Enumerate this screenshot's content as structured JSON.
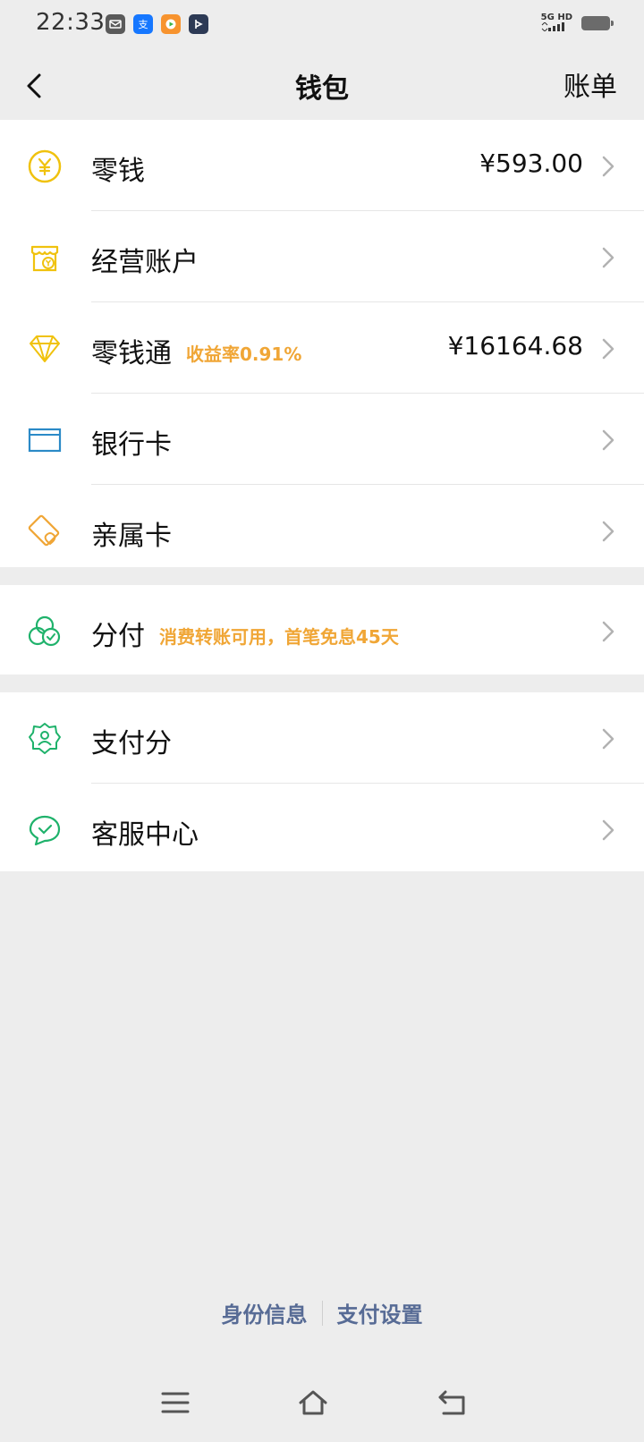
{
  "status_bar": {
    "time": "22:33",
    "network": "5G HD",
    "icons": [
      "mail-app-icon",
      "alipay-icon",
      "video-app-icon",
      "media-app-icon"
    ]
  },
  "navbar": {
    "title": "钱包",
    "right_action": "账单",
    "back_icon": "back-arrow-icon"
  },
  "groups": [
    {
      "items": [
        {
          "icon": "yen-coin-icon",
          "label": "零钱",
          "value": "¥593.00"
        },
        {
          "icon": "shop-account-icon",
          "label": "经营账户"
        },
        {
          "icon": "diamond-icon",
          "label": "零钱通",
          "tag": "收益率0.91%",
          "value": "¥16164.68"
        },
        {
          "icon": "bank-card-icon",
          "label": "银行卡"
        },
        {
          "icon": "family-card-icon",
          "label": "亲属卡"
        }
      ]
    },
    {
      "items": [
        {
          "icon": "installment-pay-icon",
          "label": "分付",
          "tag": "消费转账可用，首笔免息45天"
        }
      ]
    },
    {
      "items": [
        {
          "icon": "pay-score-icon",
          "label": "支付分"
        },
        {
          "icon": "customer-service-icon",
          "label": "客服中心"
        }
      ]
    }
  ],
  "footer": {
    "link1": "身份信息",
    "link2": "支付设置"
  },
  "colors": {
    "background": "#ededed",
    "accent_orange": "#f0a636",
    "yellow_icon": "#f0c20e",
    "blue_icon": "#2b8ac7",
    "green_icon": "#1fb26b",
    "link_blue": "#576b95"
  }
}
